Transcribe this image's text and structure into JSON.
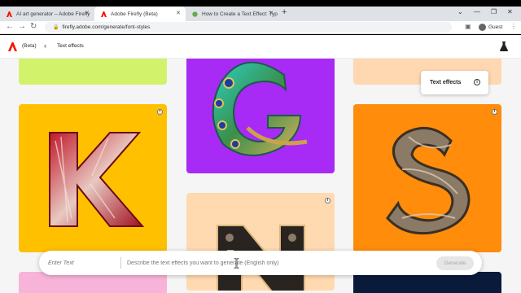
{
  "browser": {
    "tabs": [
      {
        "title": "AI art generator – Adobe Firefly",
        "active": false
      },
      {
        "title": "Adobe Firefly (Beta)",
        "active": true
      },
      {
        "title": "How to Create a Text Effect: Typ",
        "active": false
      }
    ],
    "url": "firefly.adobe.com/generate/font-styles",
    "profile_label": "Guest"
  },
  "app": {
    "beta_label": "(Beta)",
    "page_title": "Text effects"
  },
  "tooltip": {
    "label": "Text effects"
  },
  "gallery": {
    "cards": [
      {
        "letter": "",
        "bg": "#d3f26b",
        "style": "blank"
      },
      {
        "letter": "G",
        "bg": "#a82af5",
        "style": "peacock"
      },
      {
        "letter": "",
        "bg": "#ffd7b0",
        "style": "blank"
      },
      {
        "letter": "K",
        "bg": "#ffc000",
        "style": "fur"
      },
      {
        "letter": "S",
        "bg": "#ff8c0a",
        "style": "wood"
      },
      {
        "letter": "N",
        "bg": "#ffd9b0",
        "style": "metal"
      },
      {
        "letter": "",
        "bg": "#f8b4d8",
        "style": "blank"
      },
      {
        "letter": "",
        "bg": "#0a1a3a",
        "style": "blank"
      }
    ]
  },
  "prompt": {
    "text_placeholder": "Enter Text",
    "description_placeholder": "Describe the text effects you want to generate (English only)",
    "generate_label": "Generate"
  },
  "colors": {
    "accent_red": "#fa0f00",
    "background": "#f5f5f5"
  }
}
